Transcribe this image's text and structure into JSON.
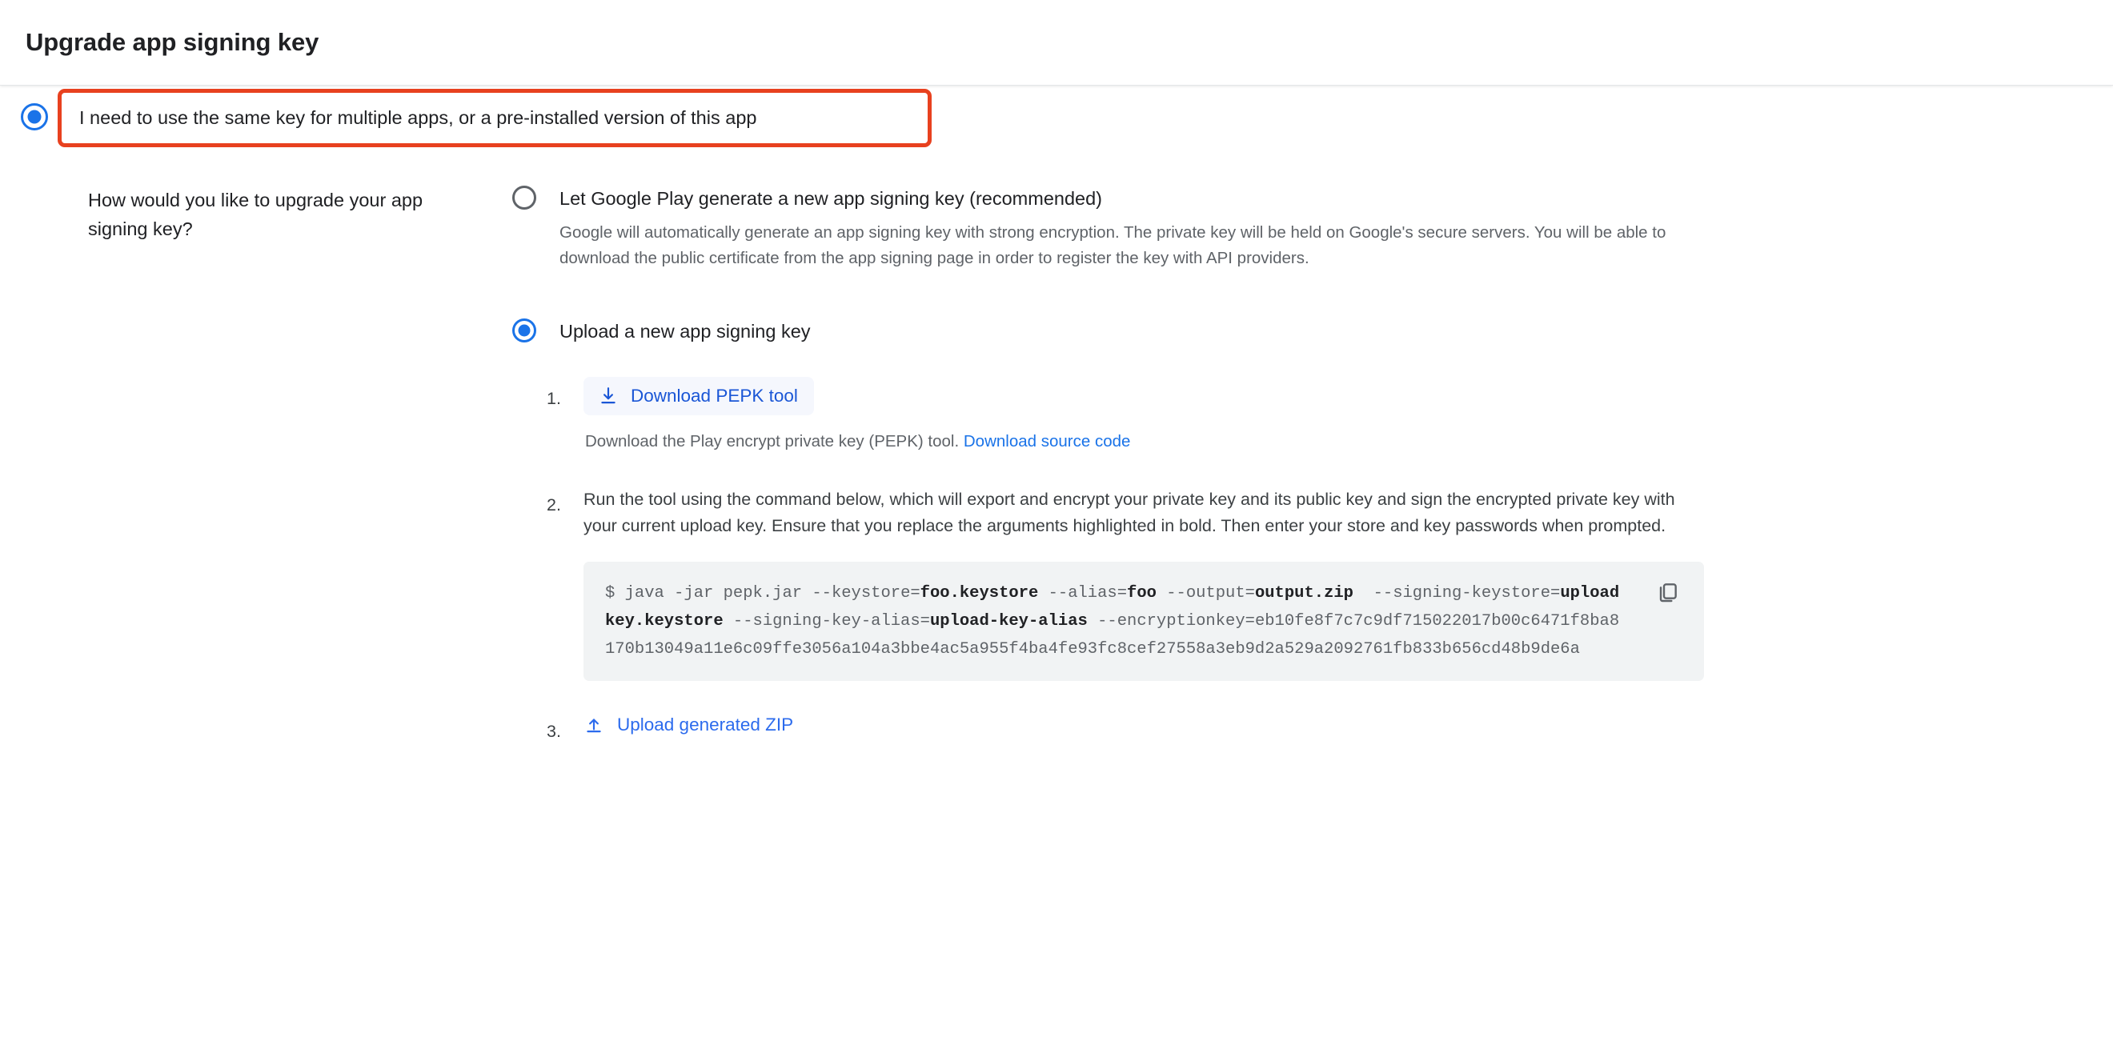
{
  "header": {
    "title": "Upgrade app signing key"
  },
  "top_option": {
    "label": "I need to use the same key for multiple apps, or a pre-installed version of this app",
    "selected": true,
    "highlight_color": "#e8411f",
    "radio_color": "#1a73e8"
  },
  "question": {
    "text": "How would you like to upgrade your app signing key?"
  },
  "options": [
    {
      "id": "generate",
      "label": "Let Google Play generate a new app signing key (recommended)",
      "selected": false,
      "description": "Google will automatically generate an app signing key with strong encryption. The private key will be held on Google's secure servers. You will be able to download the public certificate from the app signing page in order to register the key with API providers."
    },
    {
      "id": "upload",
      "label": "Upload a new app signing key",
      "selected": true
    }
  ],
  "steps": [
    {
      "number": "1.",
      "button_label": "Download PEPK tool",
      "button_icon": "download-icon",
      "caption_text": "Download the Play encrypt private key (PEPK) tool.",
      "caption_link": "Download source code"
    },
    {
      "number": "2.",
      "paragraph": "Run the tool using the command below, which will export and encrypt your private key and its public key and sign the encrypted private key with your current upload key. Ensure that you replace the arguments highlighted in bold. Then enter your store and key passwords when prompted.",
      "code": {
        "prompt": "$ ",
        "segments": [
          {
            "text": "java -jar pepk.jar --keystore=",
            "bold": false
          },
          {
            "text": "foo.keystore",
            "bold": true
          },
          {
            "text": " --alias=",
            "bold": false
          },
          {
            "text": "foo",
            "bold": true
          },
          {
            "text": " --output=",
            "bold": false
          },
          {
            "text": "output.zip",
            "bold": true
          },
          {
            "text": "  --signing-keystore=",
            "bold": false
          },
          {
            "text": "uploadkey.keystore",
            "bold": true
          },
          {
            "text": " --signing-key-alias=",
            "bold": false
          },
          {
            "text": "upload-key-alias",
            "bold": true
          },
          {
            "text": " --encryptionkey=eb10fe8f7c7c9df715022017b00c6471f8ba8170b13049a11e6c09ffe3056a104a3bbe4ac5a955f4ba4fe93fc8cef27558a3eb9d2a529a2092761fb833b656cd48b9de6a",
            "bold": false
          }
        ],
        "copy_icon": "copy-icon"
      }
    },
    {
      "number": "3.",
      "upload_label": "Upload generated ZIP",
      "upload_icon": "upload-icon"
    }
  ],
  "colors": {
    "link": "#1a73e8",
    "accent": "#1a73e8",
    "highlight": "#e8411f",
    "code_bg": "#f1f3f4",
    "chip_bg": "#f5f7fd"
  }
}
